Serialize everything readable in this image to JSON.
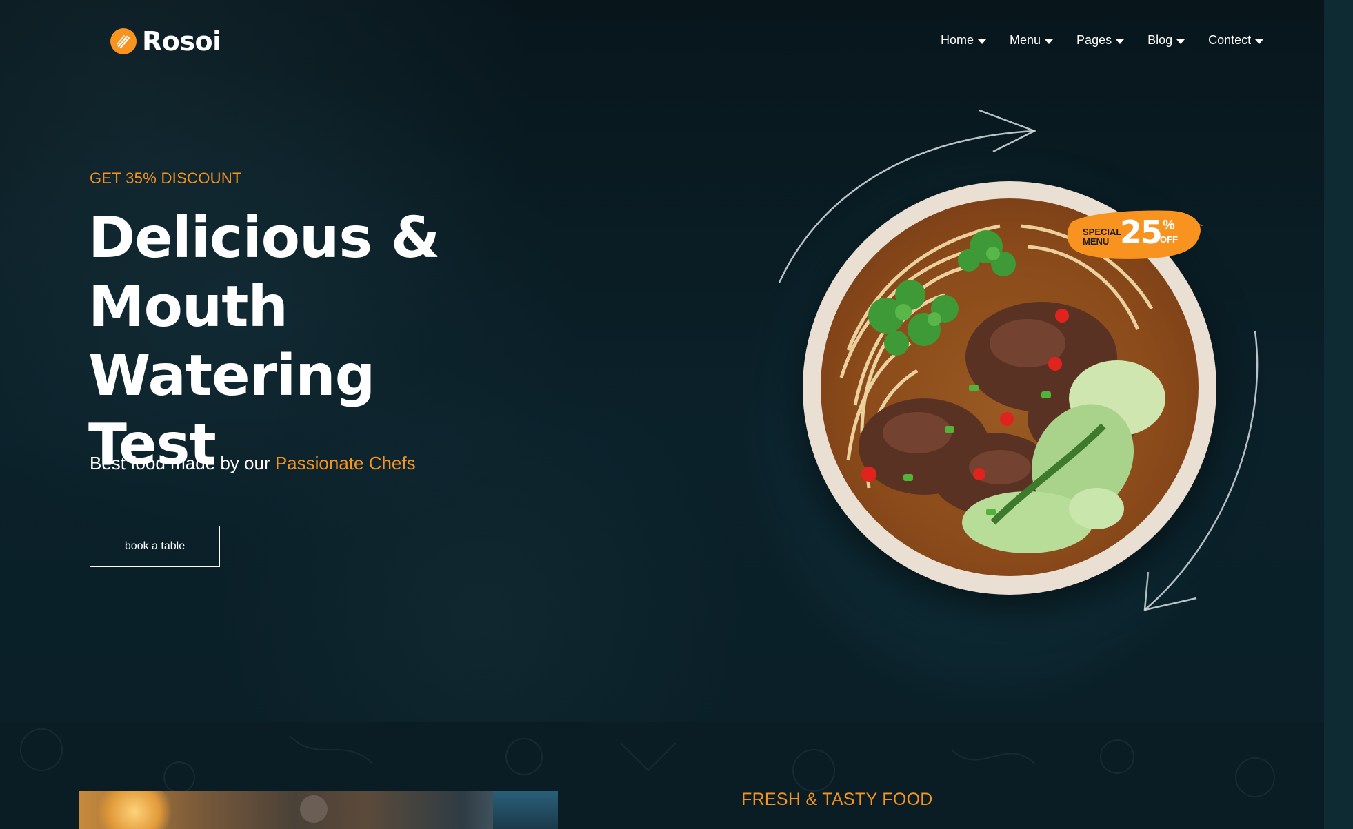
{
  "header": {
    "brand": "Rosoi",
    "nav": [
      {
        "label": "Home"
      },
      {
        "label": "Menu"
      },
      {
        "label": "Pages"
      },
      {
        "label": "Blog"
      },
      {
        "label": "Contect"
      }
    ]
  },
  "hero": {
    "eyebrow": "GET 35% DISCOUNT",
    "headline_line1": "Delicious &",
    "headline_line2": "Mouth Watering",
    "headline_line3": "Test",
    "tagline_prefix": "Best food made by our ",
    "tagline_accent": "Passionate Chefs",
    "cta_label": "book a table",
    "badge": {
      "small_line1": "SPECIAL",
      "small_line2": "MENU",
      "number": "25",
      "percent": "%",
      "off": "OFF"
    }
  },
  "section": {
    "eyebrow": "FRESH & TASTY FOOD"
  },
  "colors": {
    "accent": "#f7931e",
    "background": "#08181f",
    "text": "#ffffff"
  },
  "icons": {
    "logo": "fork-knife-icon",
    "nav_caret": "caret-down-icon",
    "arrows": "curved-arrow-icon"
  }
}
